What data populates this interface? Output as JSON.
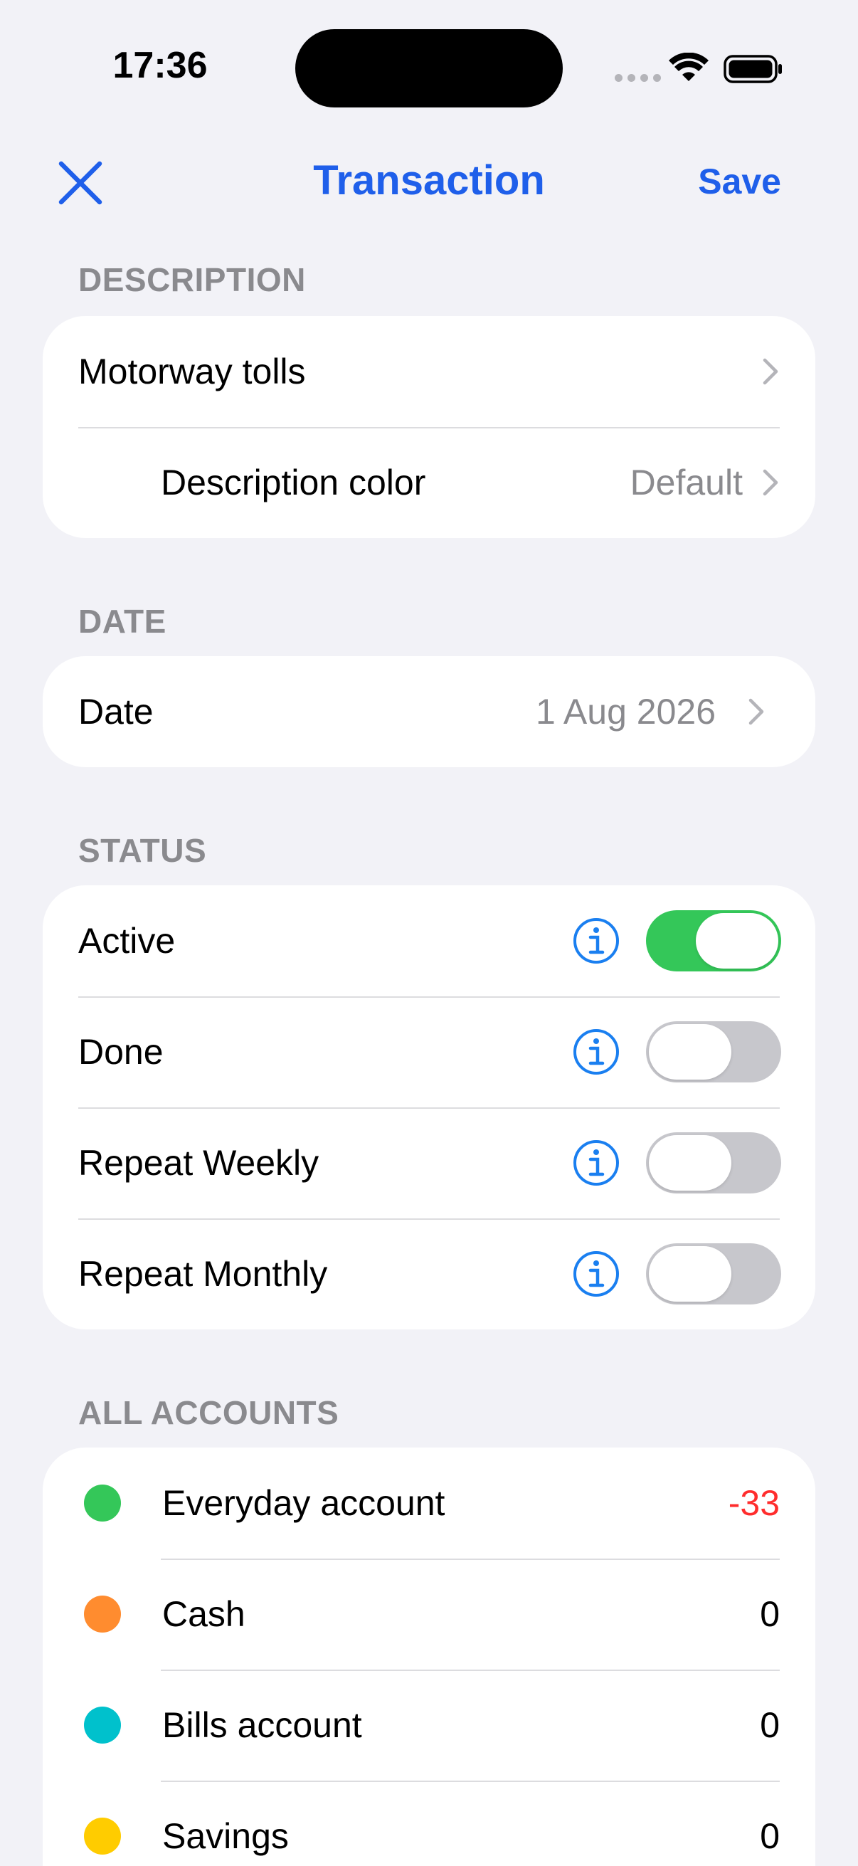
{
  "status_bar": {
    "time": "17:36"
  },
  "nav": {
    "title": "Transaction",
    "save_label": "Save"
  },
  "sections": {
    "description": {
      "header": "DESCRIPTION",
      "text": "Motorway tolls",
      "color_label": "Description color",
      "color_value": "Default"
    },
    "date": {
      "header": "DATE",
      "label": "Date",
      "value": "1 Aug 2026"
    },
    "status": {
      "header": "STATUS",
      "items": [
        {
          "label": "Active",
          "on": true
        },
        {
          "label": "Done",
          "on": false
        },
        {
          "label": "Repeat Weekly",
          "on": false
        },
        {
          "label": "Repeat Monthly",
          "on": false
        }
      ]
    },
    "accounts": {
      "header": "ALL ACCOUNTS",
      "items": [
        {
          "name": "Everyday account",
          "value": "-33",
          "color": "#34c759"
        },
        {
          "name": "Cash",
          "value": "0",
          "color": "#ff8c2f"
        },
        {
          "name": "Bills account",
          "value": "0",
          "color": "#00c1cc"
        },
        {
          "name": "Savings",
          "value": "0",
          "color": "#ffcc00"
        }
      ]
    }
  },
  "colors": {
    "accent": "#1f5fea",
    "info_icon": "#1a7ff0",
    "toggle_on": "#34c759",
    "toggle_off": "#c7c7cc",
    "negative": "#ff2d2d"
  }
}
